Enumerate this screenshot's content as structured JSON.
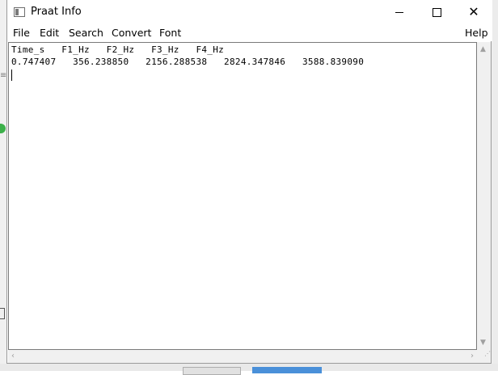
{
  "window": {
    "title": "Praat Info"
  },
  "menu": {
    "file": "File",
    "edit": "Edit",
    "search": "Search",
    "convert": "Convert",
    "font": "Font",
    "help": "Help"
  },
  "content": {
    "header_line": "Time_s   F1_Hz   F2_Hz   F3_Hz   F4_Hz",
    "data_line": "0.747407   356.238850   2156.288538   2824.347846   3588.839090"
  },
  "icons": {
    "app": "praat-info-icon",
    "minimize": "minimize-icon",
    "maximize": "maximize-icon",
    "close": "close-icon"
  }
}
